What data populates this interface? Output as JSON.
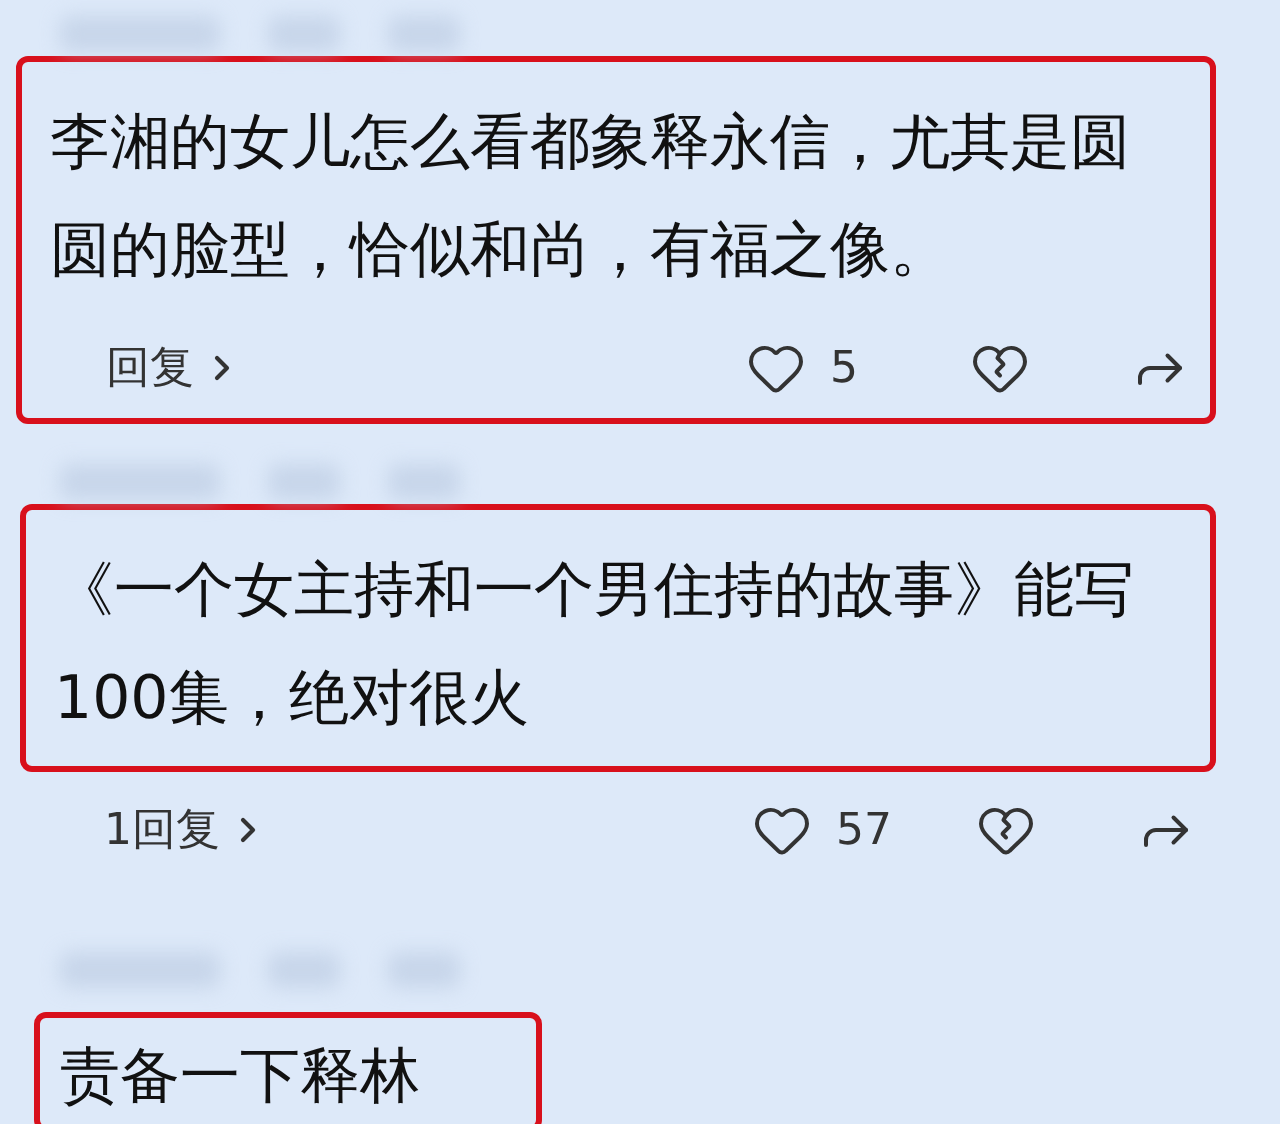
{
  "comments": [
    {
      "text": "李湘的女儿怎么看都象释永信，尤其是圆圆的脸型，恰似和尚，有福之像。",
      "reply": "回复",
      "likes": "5",
      "highlighted_reply_row": true
    },
    {
      "text": "《一个女主持和一个男住持的故事》能写100集，绝对很火",
      "reply": "1回复",
      "likes": "57",
      "highlighted_reply_row": false
    },
    {
      "text": "责备一下释林"
    }
  ]
}
